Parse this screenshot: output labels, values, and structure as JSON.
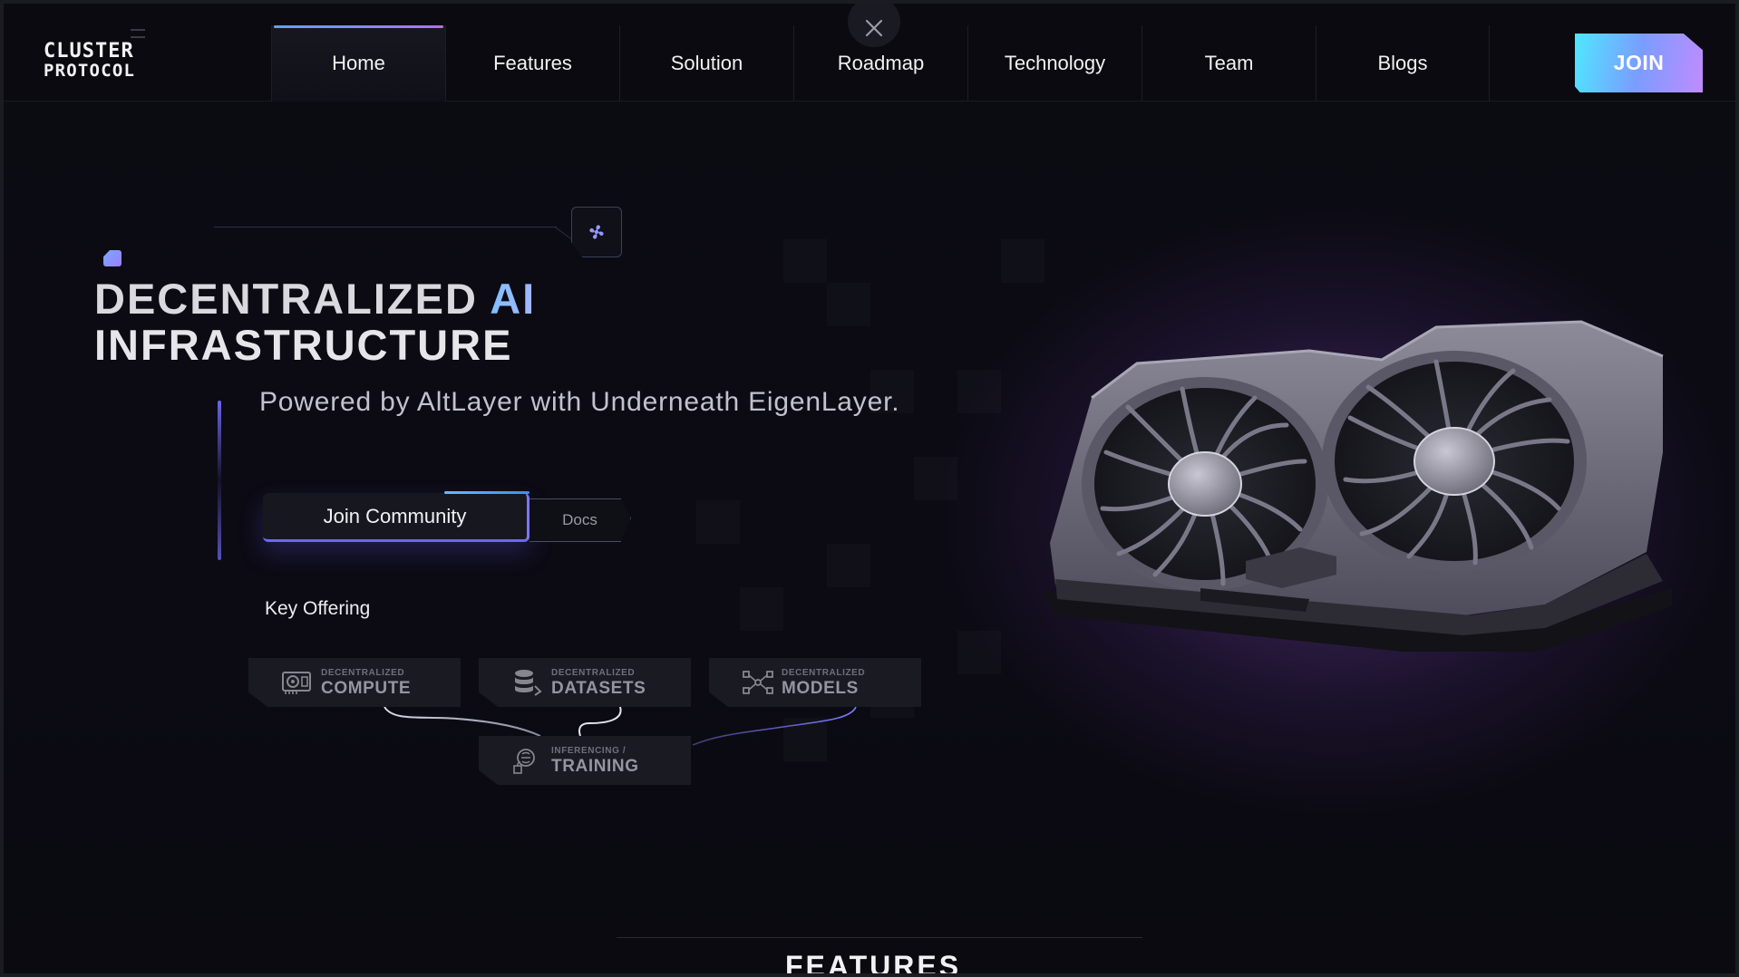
{
  "brand": {
    "line1": "CLUSTER",
    "line2": "PROTOCOL"
  },
  "nav": {
    "items": [
      {
        "label": "Home",
        "active": true
      },
      {
        "label": "Features"
      },
      {
        "label": "Solution"
      },
      {
        "label": "Roadmap"
      },
      {
        "label": "Technology"
      },
      {
        "label": "Team"
      },
      {
        "label": "Blogs"
      }
    ],
    "join_label": "JOIN",
    "close_icon": "close-icon"
  },
  "hero": {
    "title_line1_a": "DECENTRALIZED",
    "title_line1_b": "AI",
    "title_line2": "INFRASTRUCTURE",
    "subtitle": "Powered by AltLayer with Underneath EigenLayer.",
    "cta_primary": "Join Community",
    "cta_secondary": "Docs",
    "key_offering_label": "Key Offering"
  },
  "offerings": [
    {
      "small": "DECENTRALIZED",
      "big": "COMPUTE",
      "icon": "gpu-card-icon"
    },
    {
      "small": "DECENTRALIZED",
      "big": "DATASETS",
      "icon": "database-icon"
    },
    {
      "small": "DECENTRALIZED",
      "big": "MODELS",
      "icon": "network-nodes-icon"
    },
    {
      "small": "INFERENCING /",
      "big": "TRAINING",
      "icon": "brain-chip-icon"
    }
  ],
  "features": {
    "title": "FEATURES"
  },
  "colors": {
    "accent_gradient_start": "#4fe7ff",
    "accent_gradient_end": "#c08bff",
    "background": "#0b0b12",
    "glow": "#683e96"
  }
}
